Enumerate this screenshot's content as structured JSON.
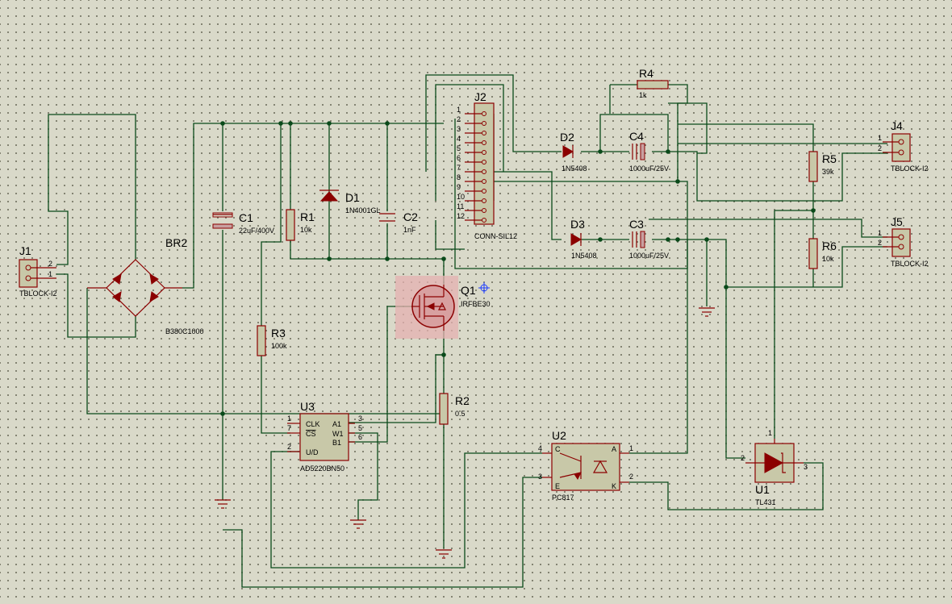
{
  "components": {
    "j1": {
      "ref": "J1",
      "value": "TBLOCK-I2",
      "pins": [
        "2",
        "1"
      ]
    },
    "br2": {
      "ref": "BR2",
      "value": "B380C1000"
    },
    "c1": {
      "ref": "C1",
      "value": "22uF/400V"
    },
    "r1": {
      "ref": "R1",
      "value": "10k"
    },
    "d1": {
      "ref": "D1",
      "value": "1N4001GL"
    },
    "c2": {
      "ref": "C2",
      "value": "1nF"
    },
    "j2": {
      "ref": "J2",
      "value": "CONN-SIL12",
      "pins": [
        "1",
        "2",
        "3",
        "4",
        "5",
        "6",
        "7",
        "8",
        "9",
        "10",
        "11",
        "12"
      ]
    },
    "r3": {
      "ref": "R3",
      "value": "100k"
    },
    "q1": {
      "ref": "Q1",
      "value": "IRFBE30"
    },
    "r2": {
      "ref": "R2",
      "value": "0.5"
    },
    "u3": {
      "ref": "U3",
      "value": "AD5220BN50",
      "pin_labels": [
        "CLK",
        "CS",
        "U/D",
        "A1",
        "W1",
        "B1"
      ],
      "pin_numbers": [
        "1",
        "7",
        "2",
        "3",
        "5",
        "6"
      ]
    },
    "u2": {
      "ref": "U2",
      "value": "PC817",
      "pin_labels": [
        "C",
        "E",
        "A",
        "K"
      ],
      "pin_numbers": [
        "4",
        "3",
        "1",
        "2"
      ]
    },
    "d2": {
      "ref": "D2",
      "value": "1N5408"
    },
    "d3": {
      "ref": "D3",
      "value": "1N5408"
    },
    "c4": {
      "ref": "C4",
      "value": "1000uF/25V"
    },
    "c3": {
      "ref": "C3",
      "value": "1000uF/25V"
    },
    "r4": {
      "ref": "R4",
      "value": "1k"
    },
    "r5": {
      "ref": "R5",
      "value": "39k"
    },
    "r6": {
      "ref": "R6",
      "value": "10k"
    },
    "j4": {
      "ref": "J4",
      "value": "TBLOCK-I2",
      "pins": [
        "1",
        "2"
      ]
    },
    "j5": {
      "ref": "J5",
      "value": "TBLOCK-I2",
      "pins": [
        "1",
        "2"
      ]
    },
    "u1": {
      "ref": "U1",
      "value": "TL431",
      "pins": [
        "1",
        "2",
        "3"
      ]
    }
  },
  "colors": {
    "wire": "#0a4a1a",
    "component": "#8b0000",
    "component_fill": "#c8c8a8",
    "selection": "#e8a0a0",
    "background": "#d9d9c9"
  }
}
